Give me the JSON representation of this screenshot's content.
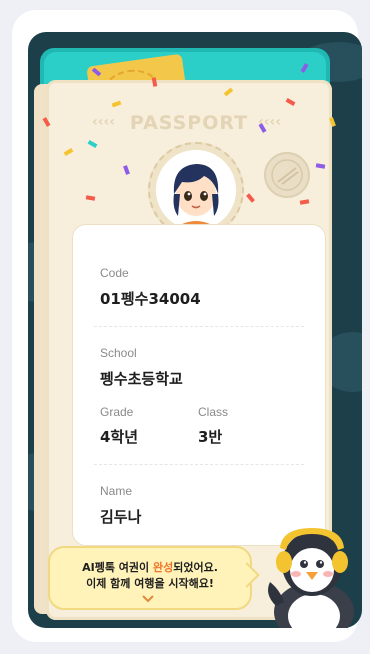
{
  "passport": {
    "title": "PASSPORT",
    "left_arrows": "‹‹‹‹",
    "right_arrows": "‹‹‹‹"
  },
  "profile": {
    "code_label": "Code",
    "code_value": "01펭수34004",
    "school_label": "School",
    "school_value": "펭수초등학교",
    "grade_label": "Grade",
    "grade_value": "4학년",
    "class_label": "Class",
    "class_value": "3반",
    "name_label": "Name",
    "name_value": "김두나"
  },
  "message": {
    "line1_prefix": "AI펭톡 여권이 ",
    "line1_highlight": "완성",
    "line1_suffix": "되었어요.",
    "line2": "이제 함께 여행을 시작해요!"
  },
  "colors": {
    "cover": "#1fb8b2",
    "highlight": "#f0732a",
    "bubble": "#fff3ba"
  },
  "icons": [
    "passport-stamp-icon",
    "chevron-down-icon"
  ]
}
